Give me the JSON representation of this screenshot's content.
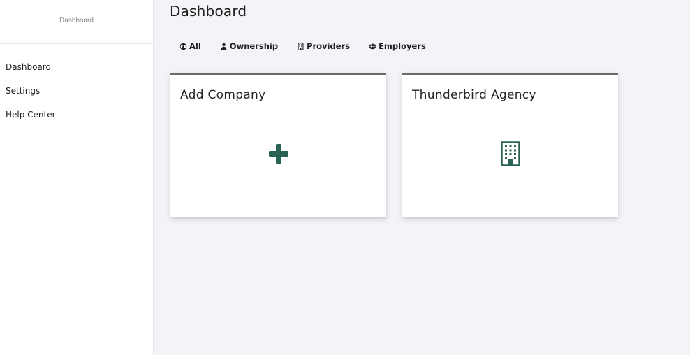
{
  "sidebar": {
    "brand": "Dashboard",
    "items": [
      {
        "label": "Dashboard"
      },
      {
        "label": "Settings"
      },
      {
        "label": "Help Center"
      }
    ]
  },
  "main": {
    "title": "Dashboard",
    "filters": [
      {
        "label": "All",
        "icon": "globe-icon"
      },
      {
        "label": "Ownership",
        "icon": "user-icon"
      },
      {
        "label": "Providers",
        "icon": "building-icon"
      },
      {
        "label": "Employers",
        "icon": "users-icon"
      }
    ],
    "cards": [
      {
        "title": "Add Company",
        "icon": "plus-icon"
      },
      {
        "title": "Thunderbird Agency",
        "icon": "building-icon"
      }
    ]
  },
  "colors": {
    "accent": "#2a6356",
    "card_border": "#6c6c6c",
    "background": "#f4f4f8"
  }
}
